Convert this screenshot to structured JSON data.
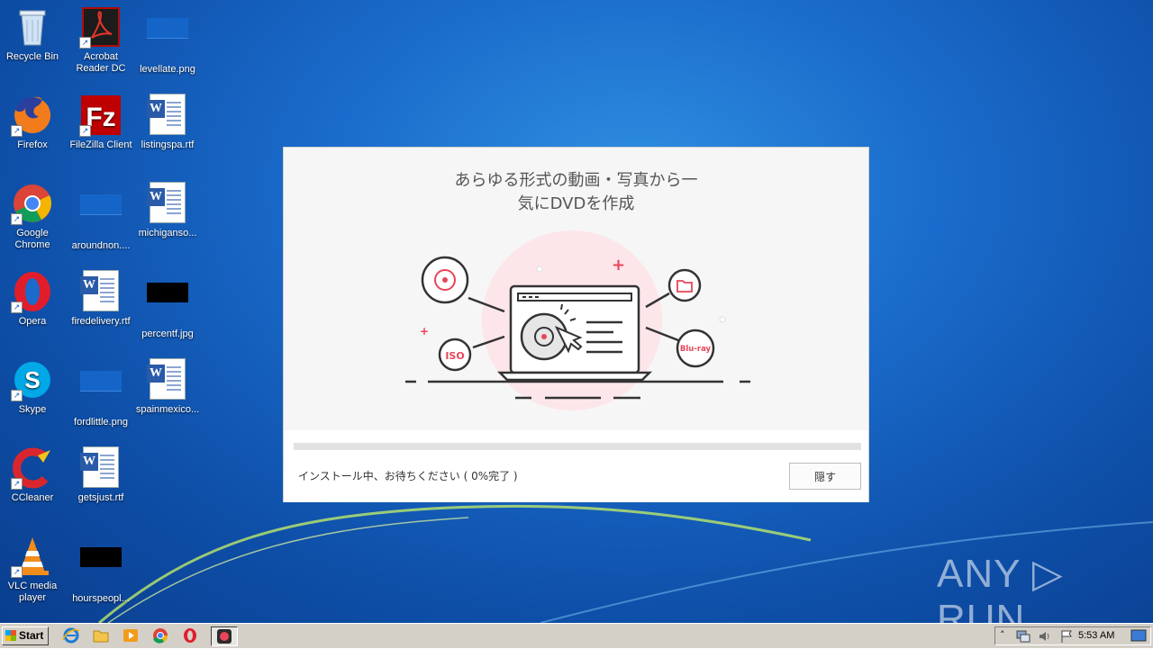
{
  "desktop": {
    "icons": [
      {
        "label": "Recycle Bin"
      },
      {
        "label": "Acrobat Reader DC"
      },
      {
        "label": "levellate.png"
      },
      {
        "label": "Firefox"
      },
      {
        "label": "FileZilla Client"
      },
      {
        "label": "listingspa.rtf"
      },
      {
        "label": "Google Chrome"
      },
      {
        "label": "aroundnon...."
      },
      {
        "label": "michiganso..."
      },
      {
        "label": "Opera"
      },
      {
        "label": "firedelivery.rtf"
      },
      {
        "label": "percentf.jpg"
      },
      {
        "label": "Skype"
      },
      {
        "label": "fordlittle.png"
      },
      {
        "label": "spainmexico..."
      },
      {
        "label": "CCleaner"
      },
      {
        "label": "getsjust.rtf"
      },
      {
        "label": "VLC media player"
      },
      {
        "label": "hourspeopl..."
      }
    ]
  },
  "dialog": {
    "title_line1": "あらゆる形式の動画・写真から一",
    "title_line2": "気にDVDを作成",
    "illustration": {
      "iso_label": "ISO",
      "bluray_label": "Blu-ray"
    },
    "progress_percent": 0,
    "status_text": "インストール中、お待ちください ( 0%完了 )",
    "hide_button_label": "隠す",
    "accent_color": "#e8455a"
  },
  "watermark": {
    "text": "ANY ▷ RUN"
  },
  "taskbar": {
    "start_label": "Start",
    "clock": "5:53 AM"
  }
}
